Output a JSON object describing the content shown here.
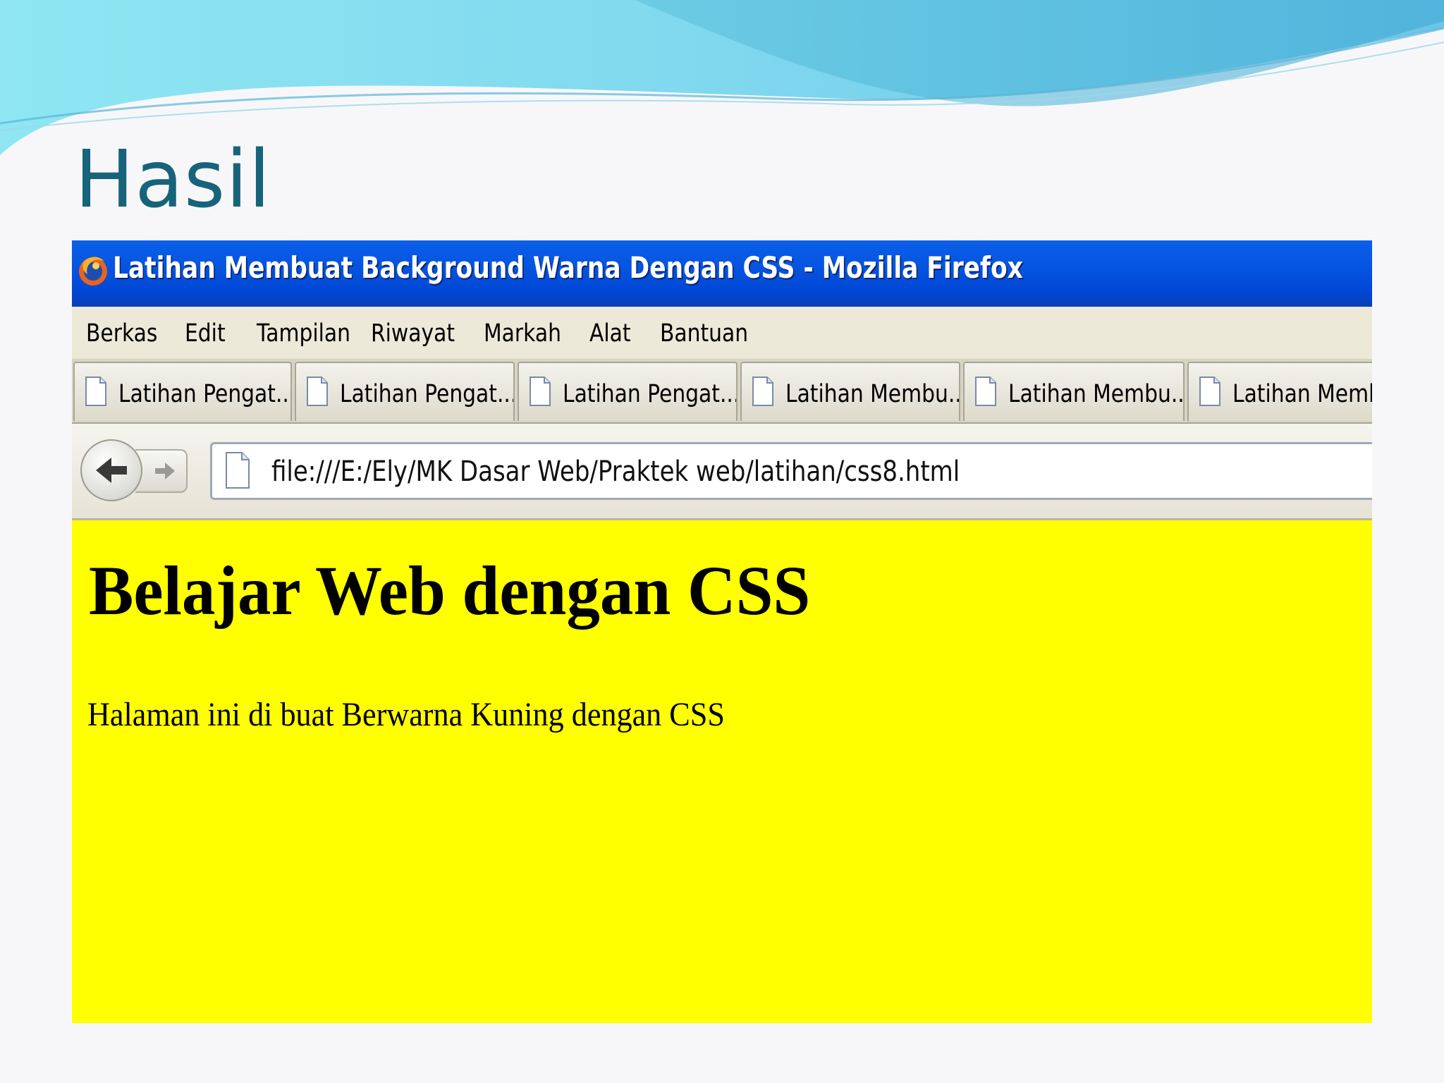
{
  "slide": {
    "title": "Hasil"
  },
  "browser": {
    "window_title": "Latihan Membuat Background Warna Dengan CSS - Mozilla Firefox",
    "menu": [
      "Berkas",
      "Edit",
      "Tampilan",
      "Riwayat",
      "Markah",
      "Alat",
      "Bantuan"
    ],
    "tabs": [
      {
        "label": "Latihan Pengat..."
      },
      {
        "label": "Latihan Pengat..."
      },
      {
        "label": "Latihan Pengat..."
      },
      {
        "label": "Latihan Membu..."
      },
      {
        "label": "Latihan Membu..."
      },
      {
        "label": "Latihan Memb"
      }
    ],
    "url": "file:///E:/Ely/MK Dasar Web/Praktek web/latihan/css8.html",
    "icons": {
      "app": "firefox-icon",
      "tab": "page-icon",
      "back": "back-arrow-icon",
      "forward": "forward-arrow-icon"
    }
  },
  "page": {
    "heading": "Belajar Web dengan CSS",
    "paragraph": "Halaman ini di buat Berwarna Kuning dengan CSS",
    "background_color": "#ffff00"
  },
  "colors": {
    "title_text": "#17637a",
    "titlebar": "#0654e0",
    "chrome": "#ece9d8"
  }
}
